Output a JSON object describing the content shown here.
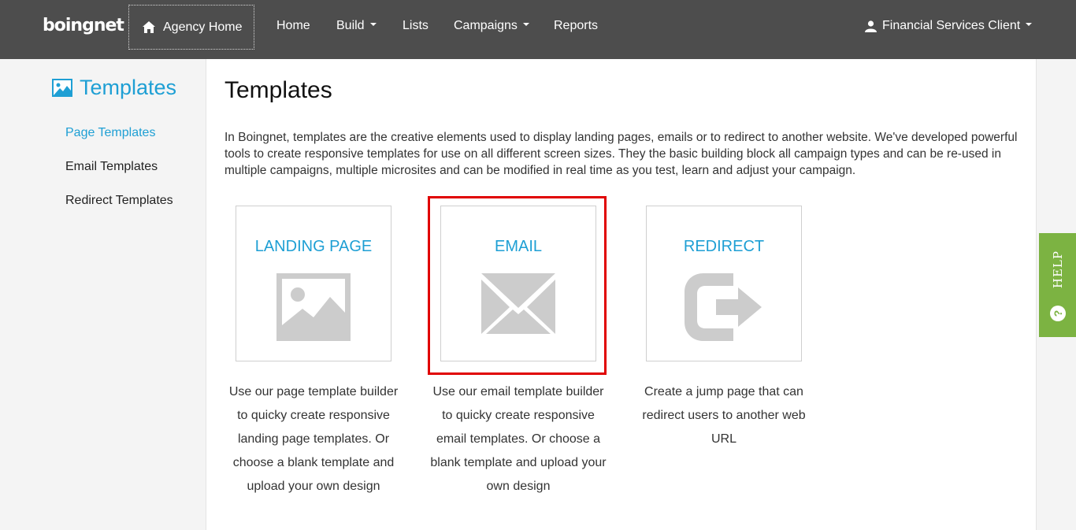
{
  "brand": {
    "logo_text": "boingnet"
  },
  "topnav": {
    "agency_home": "Agency Home",
    "items": [
      "Home",
      "Build",
      "Lists",
      "Campaigns",
      "Reports"
    ],
    "user": "Financial Services Client"
  },
  "sidebar": {
    "title": "Templates",
    "links": [
      "Page Templates",
      "Email Templates",
      "Redirect Templates"
    ],
    "active_index": 0
  },
  "main": {
    "title": "Templates",
    "intro": "In Boingnet, templates are the creative elements used to display landing pages, emails or to redirect to another website. We've developed powerful tools to create responsive templates for use on all different screen sizes. They the basic building block all campaign types and can be re-used in multiple campaigns, multiple microsites and can be modified in real time as you test, learn and adjust your campaign.",
    "cards": [
      {
        "label": "LANDING PAGE",
        "icon": "image-icon",
        "description": "Use our page template builder to quicky create responsive landing page templates. Or choose a blank template and upload your own design"
      },
      {
        "label": "EMAIL",
        "icon": "envelope-icon",
        "description": "Use our email template builder to quicky create responsive email templates. Or choose a blank template and upload your own design"
      },
      {
        "label": "REDIRECT",
        "icon": "redirect-arrow-icon",
        "description": "Create a jump page that can redirect users to another web URL"
      }
    ]
  },
  "help": {
    "label": "HELP",
    "icon_glyph": "?"
  },
  "colors": {
    "topbar": "#4d4d4d",
    "accent": "#1e9fd4",
    "help": "#7cb342",
    "highlight": "#e00000",
    "icon_gray": "#cccccc"
  }
}
